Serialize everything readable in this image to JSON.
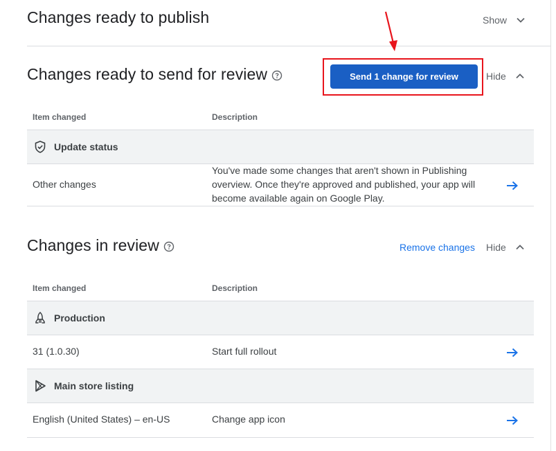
{
  "section_publish": {
    "title": "Changes ready to publish",
    "toggle": "Show"
  },
  "section_send": {
    "title": "Changes ready to send for review",
    "button": "Send 1 change for review",
    "toggle": "Hide",
    "columns": [
      "Item changed",
      "Description"
    ],
    "group": "Update status",
    "row": {
      "item": "Other changes",
      "description_lines": [
        "You've made some changes that aren't shown in Publishing",
        "overview. Once they're approved and published, your app will",
        "become available again on Google Play."
      ]
    }
  },
  "section_review": {
    "title": "Changes in review",
    "remove_link": "Remove changes",
    "toggle": "Hide",
    "columns": [
      "Item changed",
      "Description"
    ],
    "groups": [
      {
        "name": "Production",
        "icon": "rocket-icon",
        "row": {
          "item": "31 (1.0.30)",
          "description": "Start full rollout"
        }
      },
      {
        "name": "Main store listing",
        "icon": "play-store-icon",
        "row": {
          "item": "English (United States) – en-US",
          "description": "Change app icon"
        }
      }
    ]
  },
  "colors": {
    "primary_button": "#1a5fc4",
    "link": "#1a73e8",
    "annotation_red": "#e8141c",
    "group_row_bg": "#f1f3f4"
  }
}
